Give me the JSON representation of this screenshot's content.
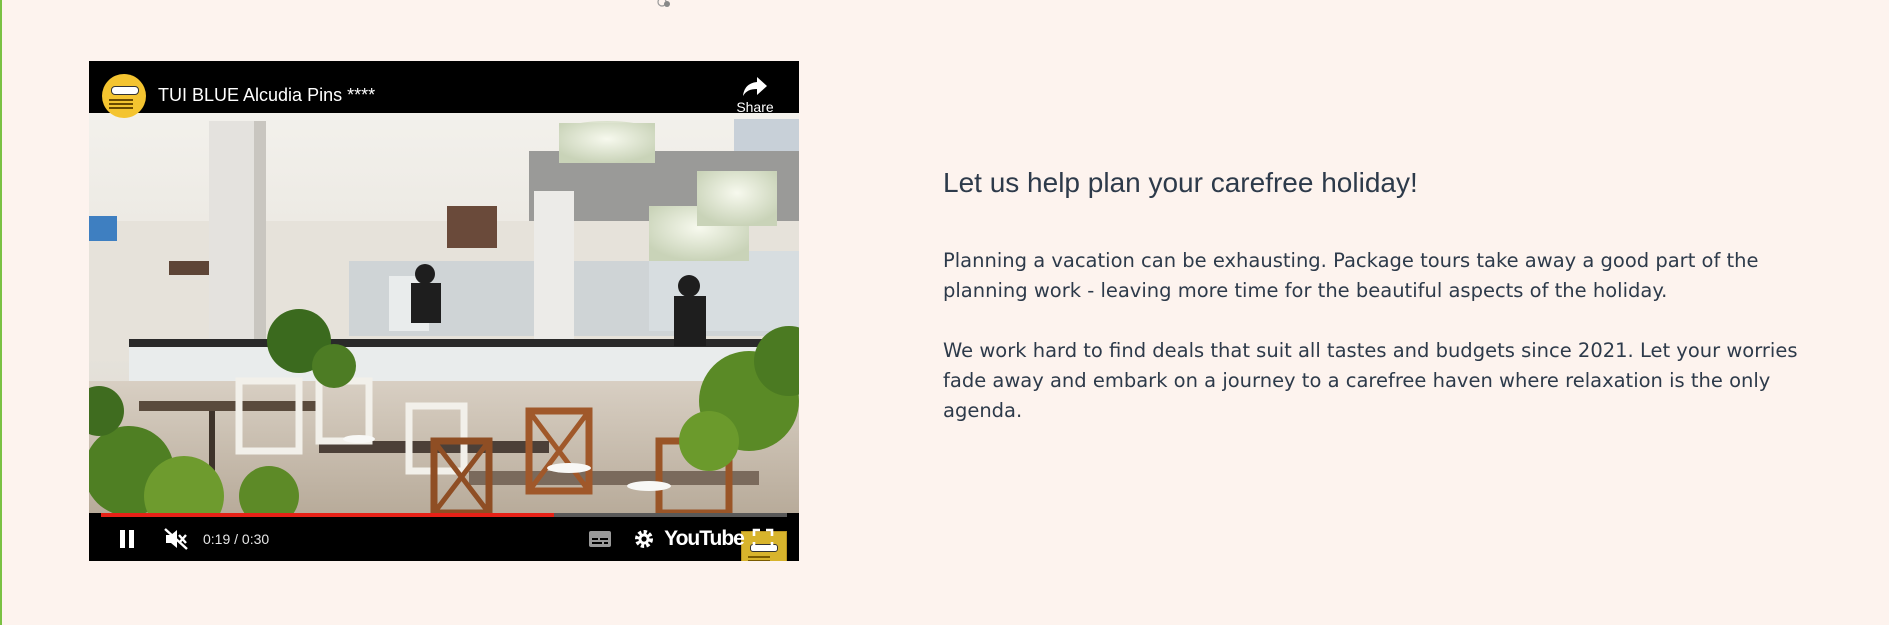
{
  "accent_color": "#7ac143",
  "page_background": "#fdf3ee",
  "video": {
    "title": "TUI BLUE Alcudia Pins ****",
    "share_label": "Share",
    "time": "0:19 / 0:30",
    "progress": 0.66,
    "youtube_label": "YouTube",
    "progress_color": "#e62117",
    "icons": [
      "share-icon",
      "pause-icon",
      "muted-volume-icon",
      "subtitles-icon",
      "settings-gear-icon",
      "fullscreen-icon"
    ]
  },
  "content": {
    "heading": "Let us help plan your carefree holiday!",
    "paragraph1": "Planning a vacation can be exhausting. Package tours take away a good part of the planning work - leaving more time for the beautiful aspects of the holiday.",
    "paragraph2": "We work hard to find deals that suit all tastes and budgets since 2021. Let your worries fade away and embark on a journey to a carefree haven where relaxation is the only agenda."
  }
}
